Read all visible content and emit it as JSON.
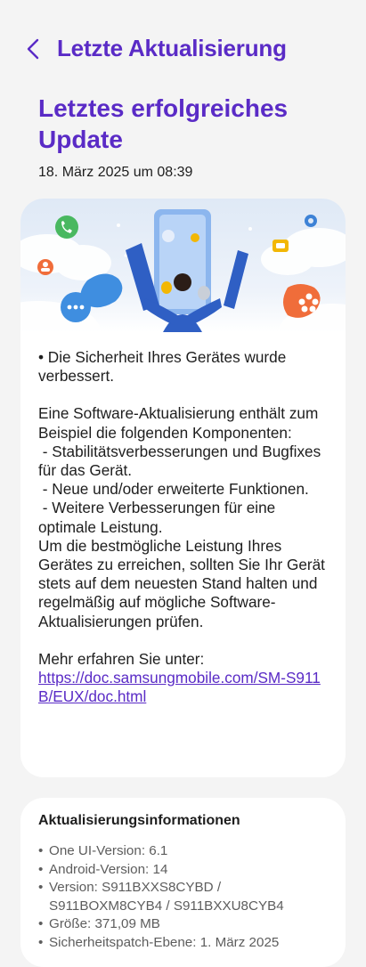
{
  "header": {
    "title": "Letzte Aktualisierung",
    "back_icon": "chevron-left-icon"
  },
  "page": {
    "title": "Letztes erfolgreiches Update",
    "date": "18. März 2025 um 08:39"
  },
  "hero": {
    "illustration": "people-with-phones-illustration",
    "icons": [
      "phone-icon",
      "settings-icon",
      "chat-icon",
      "message-icon",
      "flower-icon",
      "contact-icon"
    ]
  },
  "notes": {
    "bullet": "• Die Sicherheit Ihres Gerätes wurde verbessert.",
    "intro": "Eine Software-Aktualisierung enthält zum Beispiel die folgenden Komponenten:",
    "item1": " - Stabilitätsverbesserungen und Bugfixes für das Gerät.",
    "item2": " - Neue und/oder erweiterte Funktionen.",
    "item3": " - Weitere Verbesserungen für eine optimale Leistung.",
    "recommendation": "Um die bestmögliche Leistung Ihres Gerätes zu erreichen, sollten Sie Ihr Gerät stets auf dem neuesten Stand halten und regelmäßig auf mögliche Software-Aktualisierungen prüfen.",
    "more_label": "Mehr erfahren Sie unter:",
    "more_link": "https://doc.samsungmobile.com/SM-S911B/EUX/doc.html"
  },
  "info": {
    "title": "Aktualisierungsinformationen",
    "one_ui": "One UI-Version: 6.1",
    "android": "Android-Version: 14",
    "version": "Version: S911BXXS8CYBD / S911BOXM8CYB4 / S911BXXU8CYB4",
    "size": "Größe: 371,09 MB",
    "security_patch": "Sicherheitspatch-Ebene: 1. März 2025"
  },
  "colors": {
    "accent": "#5a2bc6",
    "background": "#f4f4f4",
    "card": "#ffffff",
    "secondary_text": "#5d5d5d"
  }
}
